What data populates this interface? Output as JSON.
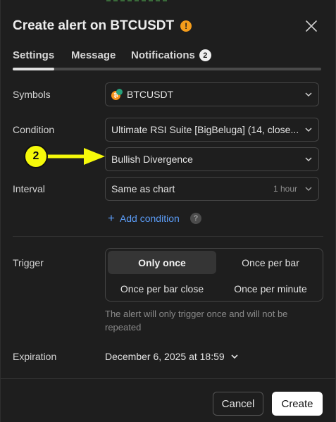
{
  "dialog": {
    "title": "Create alert on BTCUSDT",
    "warning_icon": "!",
    "close_icon": "close-icon"
  },
  "tabs": [
    {
      "label": "Settings",
      "active": true
    },
    {
      "label": "Message",
      "active": false
    },
    {
      "label": "Notifications",
      "badge": "2",
      "active": false
    }
  ],
  "symbols": {
    "label": "Symbols",
    "value": "BTCUSDT",
    "coin_glyph": "₿"
  },
  "condition": {
    "label": "Condition",
    "value": "Ultimate RSI Suite [BigBeluga] (14, close...",
    "sub_value": "Bullish Divergence"
  },
  "interval": {
    "label": "Interval",
    "value": "Same as chart",
    "hint": "1 hour"
  },
  "add_condition": {
    "label": "Add condition",
    "plus": "+",
    "help": "?"
  },
  "trigger": {
    "label": "Trigger",
    "options": [
      "Only once",
      "Once per bar",
      "Once per bar close",
      "Once per minute"
    ],
    "selected": "Only once",
    "note": "The alert will only trigger once and will not be repeated"
  },
  "expiration": {
    "label": "Expiration",
    "value": "December 6, 2025 at 18:59"
  },
  "buttons": {
    "cancel": "Cancel",
    "create": "Create"
  },
  "annotation": {
    "step_number": "2",
    "color": "#f5f90a"
  }
}
